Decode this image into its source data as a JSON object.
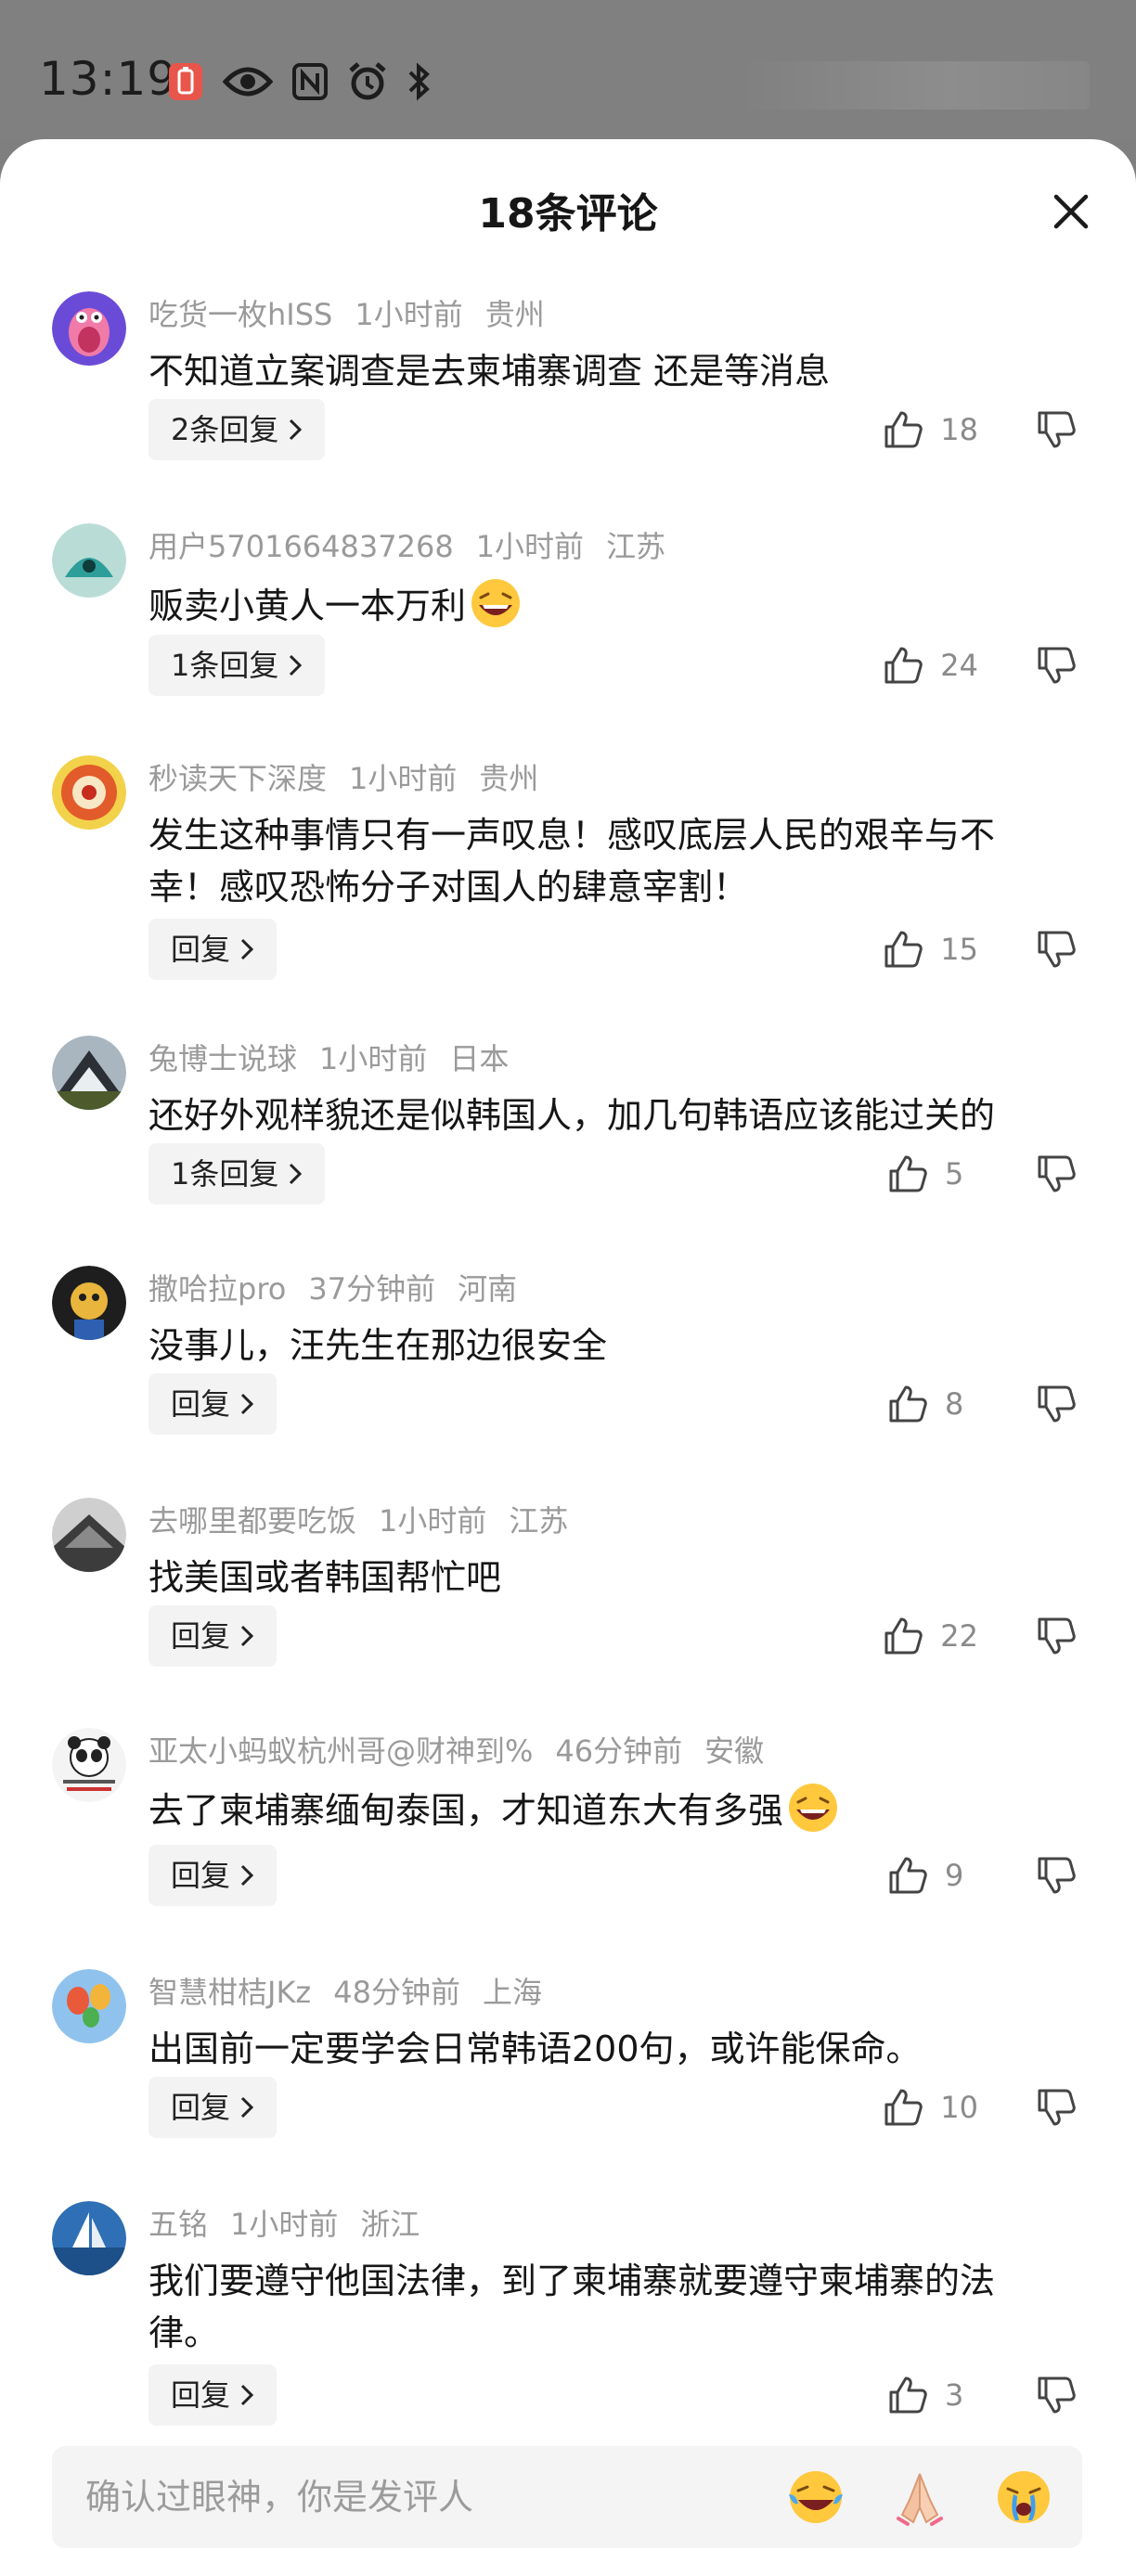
{
  "status_bar": {
    "time": "13:19",
    "icons": [
      "notification-badge-icon",
      "eye-icon",
      "nfc-icon",
      "alarm-icon",
      "bluetooth-icon"
    ]
  },
  "sheet": {
    "title": "18条评论",
    "close_icon": "close-icon"
  },
  "comments": [
    {
      "user": "吃货一枚hISS",
      "time": "1小时前",
      "location": "贵州",
      "text": "不知道立案调查是去柬埔寨调查 还是等消息",
      "reply_label": "2条回复",
      "likes": "18",
      "avatar_color": "#6a4bd8"
    },
    {
      "user": "用户5701664837268",
      "time": "1小时前",
      "location": "江苏",
      "text": "贩卖小黄人一本万利",
      "emoji": "laughing-emoji",
      "reply_label": "1条回复",
      "likes": "24",
      "avatar_color": "#3bb3b0"
    },
    {
      "user": "秒读天下深度",
      "time": "1小时前",
      "location": "贵州",
      "text": "发生这种事情只有一声叹息！感叹底层人民的艰辛与不幸！感叹恐怖分子对国人的肆意宰割！",
      "reply_label": "回复",
      "likes": "15",
      "avatar_color": "#e25b2a"
    },
    {
      "user": "兔博士说球",
      "time": "1小时前",
      "location": "日本",
      "text": "还好外观样貌还是似韩国人，加几句韩语应该能过关的",
      "reply_label": "1条回复",
      "likes": "5",
      "avatar_color": "#5b6b78"
    },
    {
      "user": "撒哈拉pro",
      "time": "37分钟前",
      "location": "河南",
      "text": "没事儿，汪先生在那边很安全",
      "reply_label": "回复",
      "likes": "8",
      "avatar_color": "#2a2a2a"
    },
    {
      "user": "去哪里都要吃饭",
      "time": "1小时前",
      "location": "江苏",
      "text": "找美国或者韩国帮忙吧",
      "reply_label": "回复",
      "likes": "22",
      "avatar_color": "#4a4a4a"
    },
    {
      "user": "亚太小蚂蚁杭州哥@财神到%",
      "time": "46分钟前",
      "location": "安徽",
      "text": "去了柬埔寨缅甸泰国，才知道东大有多强",
      "emoji": "laughing-emoji",
      "reply_label": "回复",
      "likes": "9",
      "avatar_color": "#f2f2f2"
    },
    {
      "user": "智慧柑桔JKz",
      "time": "48分钟前",
      "location": "上海",
      "text": "出国前一定要学会日常韩语200句，或许能保命。",
      "reply_label": "回复",
      "likes": "10",
      "avatar_color": "#4f8fd6"
    },
    {
      "user": "五铭",
      "time": "1小时前",
      "location": "浙江",
      "text": "我们要遵守他国法律，到了柬埔寨就要遵守柬埔寨的法律。",
      "reply_label": "回复",
      "likes": "3",
      "avatar_color": "#2f6fb5"
    }
  ],
  "input_bar": {
    "placeholder": "确认过眼神，你是发评人",
    "quick_emojis": [
      "laughing-crying-emoji",
      "praying-hands-emoji",
      "crying-emoji"
    ]
  }
}
